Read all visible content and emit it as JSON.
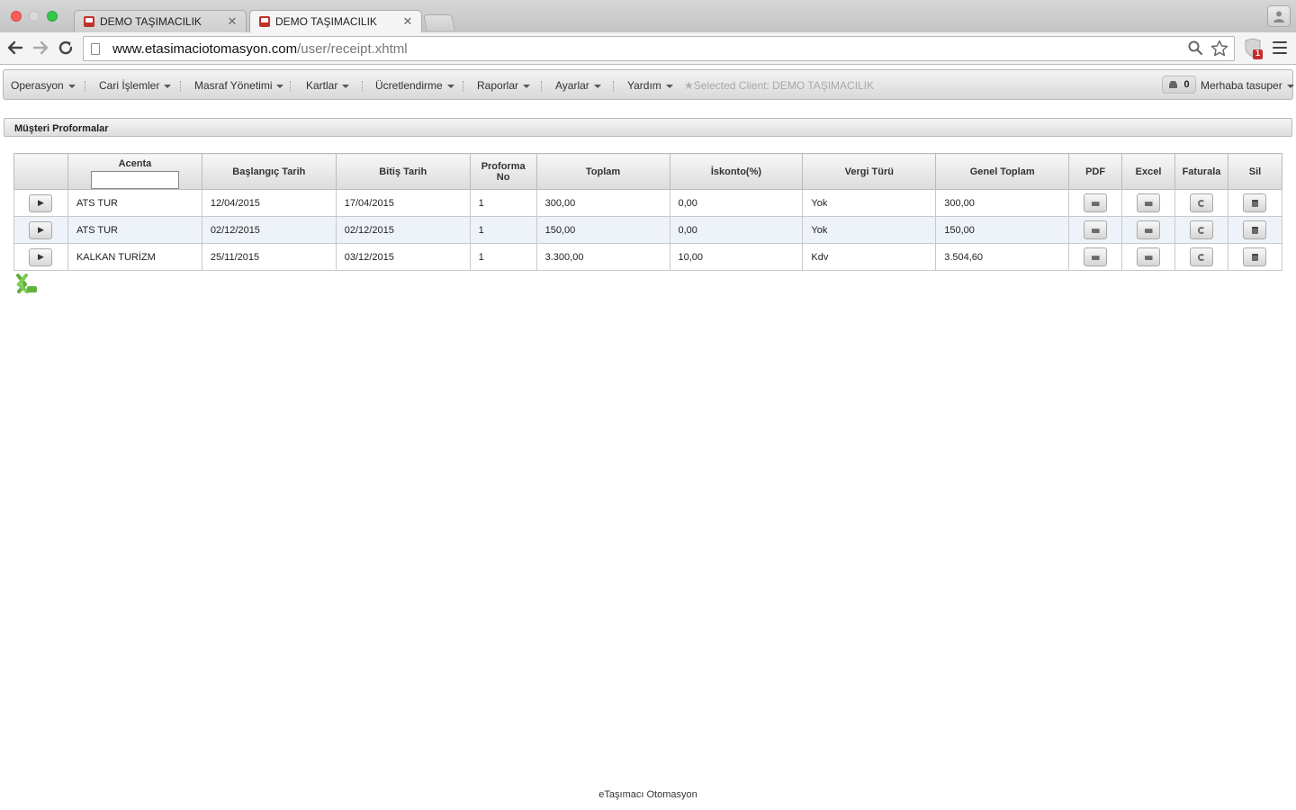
{
  "browser": {
    "tabs": [
      {
        "title": "DEMO TAŞIMACILIK",
        "active": false
      },
      {
        "title": "DEMO TAŞIMACILIK",
        "active": true
      }
    ],
    "url_host": "www.etasimaciotomasyon.com",
    "url_path": "/user/receipt.xhtml",
    "extension_badge": "1"
  },
  "menubar": {
    "items": [
      "Operasyon",
      "Cari İşlemler",
      "Masraf Yönetimi",
      "Kartlar",
      "Ücretlendirme",
      "Raporlar",
      "Ayarlar",
      "Yardım"
    ],
    "selected_client": "Selected Client: DEMO TAŞIMACILIK",
    "notification_count": "0",
    "greeting": "Merhaba tasuper"
  },
  "panel": {
    "title": "Müşteri Proformalar"
  },
  "table": {
    "columns": {
      "acenta": "Acenta",
      "baslangic": "Başlangıç Tarih",
      "bitis": "Bitiş Tarih",
      "proforma_line1": "Proforma",
      "proforma_line2": "No",
      "toplam": "Toplam",
      "iskonto": "İskonto(%)",
      "vergi": "Vergi Türü",
      "genel": "Genel Toplam",
      "pdf": "PDF",
      "excel": "Excel",
      "faturala": "Faturala",
      "sil": "Sil"
    },
    "filter_value": "",
    "rows": [
      {
        "acenta": "ATS TUR",
        "baslangic": "12/04/2015",
        "bitis": "17/04/2015",
        "proforma_no": "1",
        "toplam": "300,00",
        "iskonto": "0,00",
        "vergi": "Yok",
        "genel": "300,00"
      },
      {
        "acenta": "ATS TUR",
        "baslangic": "02/12/2015",
        "bitis": "02/12/2015",
        "proforma_no": "1",
        "toplam": "150,00",
        "iskonto": "0,00",
        "vergi": "Yok",
        "genel": "150,00"
      },
      {
        "acenta": "KALKAN TURİZM",
        "baslangic": "25/11/2015",
        "bitis": "03/12/2015",
        "proforma_no": "1",
        "toplam": "3.300,00",
        "iskonto": "10,00",
        "vergi": "Kdv",
        "genel": "3.504,60"
      }
    ]
  },
  "footer": {
    "text": "eTaşımacı Otomasyon"
  },
  "colors": {
    "accent_green": "#5fb13a",
    "favicon_red": "#c0332b",
    "row_alt": "#eef3f9"
  }
}
